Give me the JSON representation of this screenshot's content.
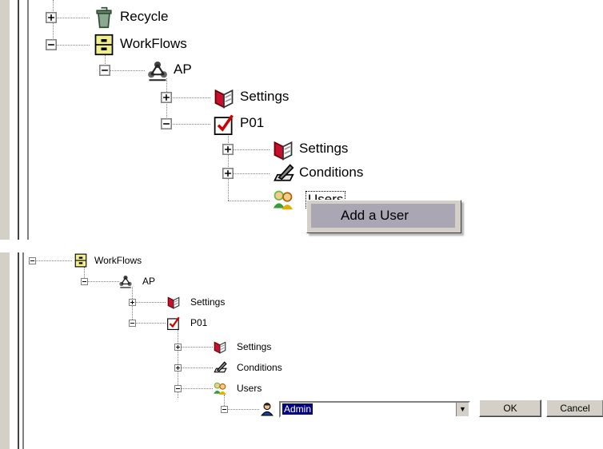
{
  "panel1": {
    "nodes": {
      "recycle": "Recycle",
      "workflows": "WorkFlows",
      "ap": "AP",
      "settings_ap": "Settings",
      "p01": "P01",
      "settings_p01": "Settings",
      "conditions": "Conditions",
      "users": "Users"
    },
    "context_menu": {
      "add_user": "Add a User"
    }
  },
  "panel2": {
    "nodes": {
      "workflows": "WorkFlows",
      "ap": "AP",
      "settings_ap": "Settings",
      "p01": "P01",
      "settings_p01": "Settings",
      "conditions": "Conditions",
      "users": "Users"
    },
    "user_combo": {
      "value": "Admin"
    },
    "ok_label": "OK",
    "cancel_label": "Cancel"
  },
  "expanders": {
    "plus": "+",
    "minus": "−"
  },
  "icons": {
    "recycle": "recycle-bin-icon",
    "workflows": "cabinet-icon",
    "ap": "network-icon",
    "settings": "book-icon",
    "p01": "checkbox-icon",
    "conditions": "pen-paper-icon",
    "users": "users-icon",
    "user": "person-icon"
  },
  "colors": {
    "selection": "#000080",
    "menu_highlight": "#aaa6b4",
    "button_face": "#d4d0c8"
  }
}
